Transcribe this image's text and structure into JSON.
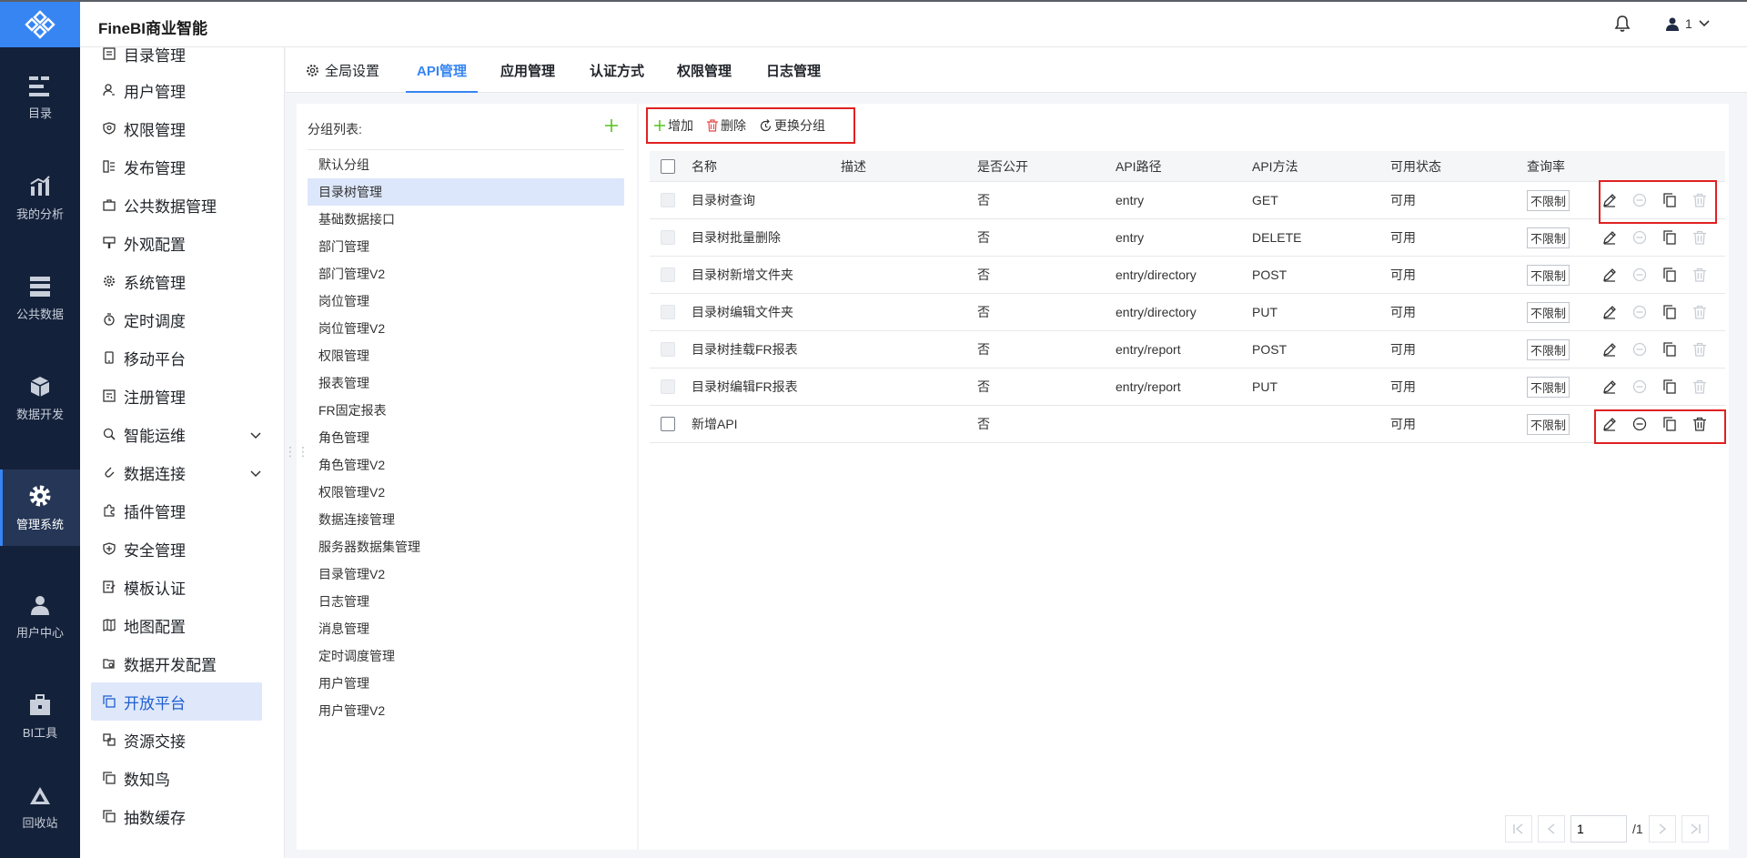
{
  "app": {
    "title": "FineBI商业智能",
    "user": "1"
  },
  "nav": [
    {
      "label": "目录",
      "icon": "catalog-icon"
    },
    {
      "label": "我的分析",
      "icon": "analysis-icon"
    },
    {
      "label": "公共数据",
      "icon": "database-icon"
    },
    {
      "label": "数据开发",
      "icon": "cube-icon"
    },
    {
      "label": "管理系统",
      "icon": "gear-icon",
      "active": true
    },
    {
      "label": "用户中心",
      "icon": "user-icon"
    },
    {
      "label": "BI工具",
      "icon": "toolbox-icon"
    },
    {
      "label": "回收站",
      "icon": "recycle-icon"
    }
  ],
  "menu": [
    {
      "label": "目录管理",
      "icon": "list-icon"
    },
    {
      "label": "用户管理",
      "icon": "user-icon"
    },
    {
      "label": "权限管理",
      "icon": "shield-icon"
    },
    {
      "label": "发布管理",
      "icon": "publish-icon"
    },
    {
      "label": "公共数据管理",
      "icon": "briefcase-icon"
    },
    {
      "label": "外观配置",
      "icon": "brush-icon"
    },
    {
      "label": "系统管理",
      "icon": "gear-icon"
    },
    {
      "label": "定时调度",
      "icon": "timer-icon"
    },
    {
      "label": "移动平台",
      "icon": "mobile-icon"
    },
    {
      "label": "注册管理",
      "icon": "register-icon"
    },
    {
      "label": "智能运维",
      "icon": "ops-icon",
      "expandable": true
    },
    {
      "label": "数据连接",
      "icon": "link-icon",
      "expandable": true
    },
    {
      "label": "插件管理",
      "icon": "plugin-icon"
    },
    {
      "label": "安全管理",
      "icon": "security-icon"
    },
    {
      "label": "模板认证",
      "icon": "template-icon"
    },
    {
      "label": "地图配置",
      "icon": "map-icon"
    },
    {
      "label": "数据开发配置",
      "icon": "dev-config-icon"
    },
    {
      "label": "开放平台",
      "icon": "copy-icon",
      "active": true
    },
    {
      "label": "资源交接",
      "icon": "resource-icon"
    },
    {
      "label": "数知鸟",
      "icon": "copy-icon"
    },
    {
      "label": "抽数缓存",
      "icon": "copy-icon"
    }
  ],
  "tabs": [
    {
      "label": "全局设置",
      "icon": "gear-icon"
    },
    {
      "label": "API管理",
      "active": true
    },
    {
      "label": "应用管理"
    },
    {
      "label": "认证方式"
    },
    {
      "label": "权限管理"
    },
    {
      "label": "日志管理"
    }
  ],
  "groups": {
    "title": "分组列表:",
    "items": [
      "默认分组",
      "目录树管理",
      "基础数据接口",
      "部门管理",
      "部门管理V2",
      "岗位管理",
      "岗位管理V2",
      "权限管理",
      "报表管理",
      "FR固定报表",
      "角色管理",
      "角色管理V2",
      "权限管理V2",
      "数据连接管理",
      "服务器数据集管理",
      "目录管理V2",
      "日志管理",
      "消息管理",
      "定时调度管理",
      "用户管理",
      "用户管理V2"
    ],
    "active": 1
  },
  "toolbar": {
    "add": "增加",
    "delete": "删除",
    "change_group": "更换分组"
  },
  "table": {
    "headers": [
      "名称",
      "描述",
      "是否公开",
      "API路径",
      "API方法",
      "可用状态",
      "查询率"
    ],
    "rows": [
      {
        "name": "目录树查询",
        "desc": "",
        "public": "否",
        "path": "entry",
        "method": "GET",
        "status": "可用",
        "rate": "不限制",
        "enabled": false
      },
      {
        "name": "目录树批量删除",
        "desc": "",
        "public": "否",
        "path": "entry",
        "method": "DELETE",
        "status": "可用",
        "rate": "不限制",
        "enabled": false
      },
      {
        "name": "目录树新增文件夹",
        "desc": "",
        "public": "否",
        "path": "entry/directory",
        "method": "POST",
        "status": "可用",
        "rate": "不限制",
        "enabled": false
      },
      {
        "name": "目录树编辑文件夹",
        "desc": "",
        "public": "否",
        "path": "entry/directory",
        "method": "PUT",
        "status": "可用",
        "rate": "不限制",
        "enabled": false
      },
      {
        "name": "目录树挂载FR报表",
        "desc": "",
        "public": "否",
        "path": "entry/report",
        "method": "POST",
        "status": "可用",
        "rate": "不限制",
        "enabled": false
      },
      {
        "name": "目录树编辑FR报表",
        "desc": "",
        "public": "否",
        "path": "entry/report",
        "method": "PUT",
        "status": "可用",
        "rate": "不限制",
        "enabled": false
      },
      {
        "name": "新增API",
        "desc": "",
        "public": "否",
        "path": "",
        "method": "",
        "status": "可用",
        "rate": "不限制",
        "enabled": true
      }
    ]
  },
  "pager": {
    "current": "1",
    "total": "/1"
  },
  "colors": {
    "accent": "#3685f2",
    "nav_bg": "#14213a",
    "highlight": "#e02020",
    "add_green": "#52c41a"
  }
}
